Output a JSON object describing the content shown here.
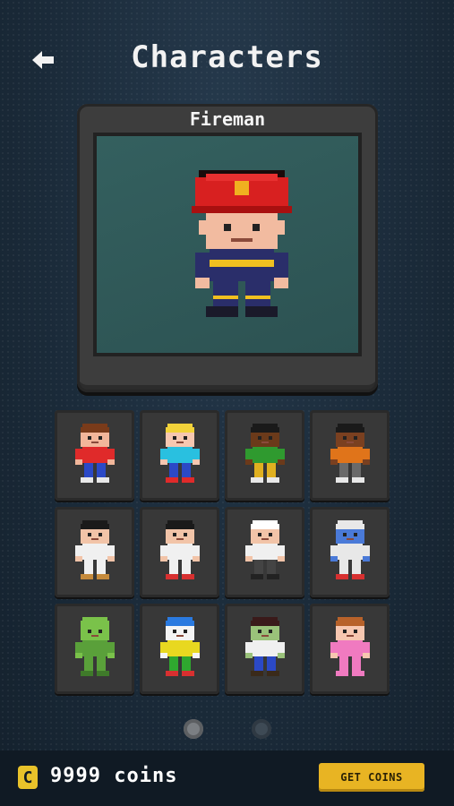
{
  "header": {
    "title": "Characters",
    "back_icon": "back-arrow-icon"
  },
  "preview": {
    "name": "Fireman"
  },
  "characters": [
    {
      "id": "boy-red-shirt",
      "colors": {
        "hair": "#7a3b1a",
        "skin": "#f2b69a",
        "shirt": "#e02a2a",
        "pants": "#2b49c6",
        "shoes": "#e8e8e8"
      }
    },
    {
      "id": "girl-blonde",
      "colors": {
        "hair": "#f2d23a",
        "skin": "#f7c7b0",
        "shirt": "#29c0e0",
        "pants": "#2b49c6",
        "shoes": "#e02a2a"
      }
    },
    {
      "id": "boy-green-shirt",
      "colors": {
        "hair": "#1a1a1a",
        "skin": "#6b3a1a",
        "shirt": "#2f9a2f",
        "pants": "#e0b020",
        "shoes": "#e8e8e8"
      }
    },
    {
      "id": "girl-orange-shirt",
      "colors": {
        "hair": "#1a1a1a",
        "skin": "#7a4020",
        "shirt": "#e0741a",
        "pants": "#6a6a6a",
        "shoes": "#e8e8e8"
      }
    },
    {
      "id": "karate-boy",
      "colors": {
        "hair": "#1a1a1a",
        "skin": "#f2c4a8",
        "shirt": "#f0f0f0",
        "pants": "#f0f0f0",
        "shoes": "#c68b3c"
      }
    },
    {
      "id": "karate-girl",
      "colors": {
        "hair": "#1a1a1a",
        "skin": "#f2c4a8",
        "shirt": "#f0f0f0",
        "pants": "#f0f0f0",
        "shoes": "#d83030"
      }
    },
    {
      "id": "chef",
      "colors": {
        "hair": "#ffffff",
        "skin": "#f2c4a8",
        "shirt": "#f0f0f0",
        "pants": "#444444",
        "shoes": "#222222"
      }
    },
    {
      "id": "astronaut",
      "colors": {
        "hair": "#e8e8e8",
        "skin": "#4a7ad8",
        "shirt": "#e8e8e8",
        "pants": "#e8e8e8",
        "shoes": "#d83030"
      }
    },
    {
      "id": "alien",
      "colors": {
        "hair": "#7ac24a",
        "skin": "#7ac24a",
        "shirt": "#5aa03a",
        "pants": "#5aa03a",
        "shoes": "#3f7a2a"
      }
    },
    {
      "id": "clown",
      "colors": {
        "hair": "#2a7ae0",
        "skin": "#f4f4f4",
        "shirt": "#e8d820",
        "pants": "#2fa82f",
        "shoes": "#d83030"
      }
    },
    {
      "id": "zombie",
      "colors": {
        "hair": "#3a1a1a",
        "skin": "#9ac27a",
        "shirt": "#f0f0f0",
        "pants": "#2b49c6",
        "shoes": "#3a2a1a"
      }
    },
    {
      "id": "girl-pink-dress",
      "colors": {
        "hair": "#b8622a",
        "skin": "#f7c7b0",
        "shirt": "#f07ac0",
        "pants": "#f07ac0",
        "shoes": "#f07ac0"
      }
    }
  ],
  "pagination": {
    "pages": 2,
    "current": 1
  },
  "footer": {
    "coin_symbol": "C",
    "coins": "9999 coins",
    "get_coins_label": "GET COINS"
  },
  "theme": {
    "accent": "#e8b423",
    "background": "#1b2b3a",
    "slot": "#383838"
  }
}
